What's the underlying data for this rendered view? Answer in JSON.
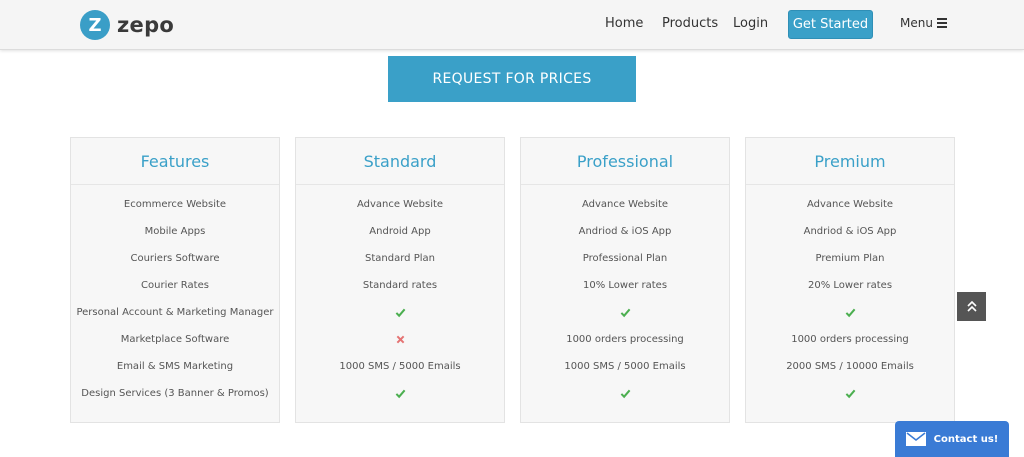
{
  "brand": {
    "logo_letter": "Z",
    "name": "zepo"
  },
  "nav": {
    "home": "Home",
    "products": "Products",
    "login": "Login",
    "get_started": "Get Started",
    "menu": "Menu"
  },
  "request_button": "REQUEST FOR PRICES",
  "plans": [
    {
      "title": "Features",
      "rows": [
        {
          "type": "text",
          "value": "Ecommerce Website"
        },
        {
          "type": "text",
          "value": "Mobile Apps"
        },
        {
          "type": "text",
          "value": "Couriers Software"
        },
        {
          "type": "text",
          "value": "Courier Rates"
        },
        {
          "type": "text",
          "value": "Personal Account & Marketing Manager"
        },
        {
          "type": "text",
          "value": "Marketplace Software"
        },
        {
          "type": "text",
          "value": "Email & SMS Marketing"
        },
        {
          "type": "text",
          "value": "Design Services (3 Banner & Promos)"
        }
      ]
    },
    {
      "title": "Standard",
      "rows": [
        {
          "type": "text",
          "value": "Advance Website"
        },
        {
          "type": "text",
          "value": "Android App"
        },
        {
          "type": "text",
          "value": "Standard Plan"
        },
        {
          "type": "text",
          "value": "Standard rates"
        },
        {
          "type": "check"
        },
        {
          "type": "cross"
        },
        {
          "type": "text",
          "value": "1000 SMS / 5000 Emails"
        },
        {
          "type": "check"
        }
      ]
    },
    {
      "title": "Professional",
      "rows": [
        {
          "type": "text",
          "value": "Advance Website"
        },
        {
          "type": "text",
          "value": "Andriod & iOS App"
        },
        {
          "type": "text",
          "value": "Professional Plan"
        },
        {
          "type": "text",
          "value": "10% Lower rates"
        },
        {
          "type": "check"
        },
        {
          "type": "text",
          "value": "1000 orders processing"
        },
        {
          "type": "text",
          "value": "1000 SMS / 5000 Emails"
        },
        {
          "type": "check"
        }
      ]
    },
    {
      "title": "Premium",
      "rows": [
        {
          "type": "text",
          "value": "Advance Website"
        },
        {
          "type": "text",
          "value": "Andriod & iOS App"
        },
        {
          "type": "text",
          "value": "Premium Plan"
        },
        {
          "type": "text",
          "value": "20% Lower rates"
        },
        {
          "type": "check"
        },
        {
          "type": "text",
          "value": "1000 orders processing"
        },
        {
          "type": "text",
          "value": "2000 SMS / 10000 Emails"
        },
        {
          "type": "check"
        }
      ]
    }
  ],
  "contact_widget": {
    "label": "Contact us!"
  },
  "icons": {
    "check": "check-icon",
    "cross": "cross-icon",
    "scroll_top": "double-chevron-up-icon",
    "mail": "envelope-icon",
    "menu": "hamburger-icon"
  },
  "colors": {
    "accent": "#3aa0c8",
    "check": "#4caf50",
    "cross": "#e57373",
    "contact": "#3a7bd5"
  }
}
